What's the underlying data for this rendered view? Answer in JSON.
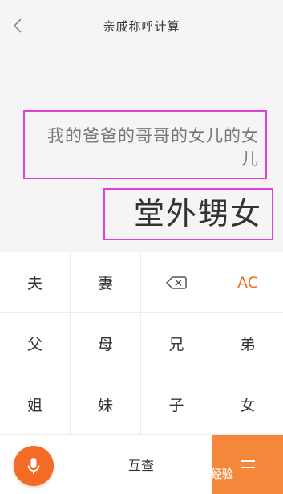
{
  "header": {
    "title": "亲戚称呼计算",
    "back_icon": "chevron-left-icon"
  },
  "display": {
    "expression": "我的爸爸的哥哥的女儿的女儿",
    "result": "堂外甥女"
  },
  "keypad": {
    "row1": [
      "夫",
      "妻",
      "",
      "AC"
    ],
    "row2": [
      "父",
      "母",
      "兄",
      "弟"
    ],
    "row3": [
      "姐",
      "妹",
      "子",
      "女"
    ],
    "swap_label": "互查",
    "mic_icon": "microphone-icon",
    "backspace_icon": "backspace-icon",
    "equals_icon": "equals-icon"
  },
  "colors": {
    "accent": "#f26d21",
    "highlight_box": "#e040d8"
  },
  "watermark": "Bai经验"
}
